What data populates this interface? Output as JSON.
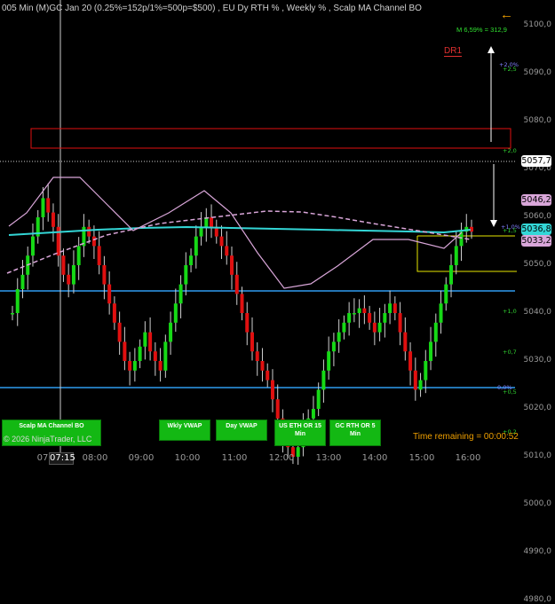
{
  "title": "005 Min (M)GC Jan 20  (0.25%=152p/1%=500p=$500) , EU Dy RTH % , Weekly % , Scalp MA Channel BO",
  "price_ticks": [
    "5100,0",
    "5090,0",
    "5080,0",
    "5070,0",
    "5060,0",
    "5050,0",
    "5040,0",
    "5030,0",
    "5020,0",
    "5010,0",
    "5000,0",
    "4990,0",
    "4980,0"
  ],
  "time_ticks": [
    "07:15",
    "08:00",
    "09:00",
    "10:00",
    "11:00",
    "12:00",
    "13:00",
    "14:00",
    "15:00",
    "16:00"
  ],
  "time_prefix": "07",
  "price_badges": [
    {
      "label": "5057,7",
      "bg": "#ffffff"
    },
    {
      "label": "5046,2",
      "bg": "#d9a6d9"
    },
    {
      "label": "5036,8",
      "bg": "#33d6d6"
    },
    {
      "label": "5033,2",
      "bg": "#d9a6d9"
    }
  ],
  "channel_labels": [
    {
      "text": "+2,5",
      "color": "#30d030"
    },
    {
      "text": "+2,0%",
      "color": "#8080ff"
    },
    {
      "text": "+2,0",
      "color": "#30d030"
    },
    {
      "text": "+1,0%",
      "color": "#8080ff"
    },
    {
      "text": "+1,5",
      "color": "#30d030"
    },
    {
      "text": "+1,0",
      "color": "#30d030"
    },
    {
      "text": "+0,7",
      "color": "#30d030"
    },
    {
      "text": "0,0%",
      "color": "#8080ff"
    },
    {
      "text": "+0,5",
      "color": "#30d030"
    },
    {
      "text": "+0,2",
      "color": "#30d030"
    }
  ],
  "measure_label": "M 6,59% = 312,9",
  "dr_label": "DR1",
  "buttons": {
    "scalp": "Scalp MA Channel BO",
    "wkly_vwap": "Wkly VWAP",
    "day_vwap": "Day VWAP",
    "us_eth": "US ETH OR 15 Min",
    "gc_rth": "GC RTH OR 5 Min"
  },
  "copyright": "© 2026 NinjaTrader, LLC",
  "time_remaining": "Time remaining = 00:00:52",
  "colors": {
    "up": "#16d916",
    "down": "#e01010",
    "magenta": "#d9a6d9",
    "cyan": "#33d6d6",
    "blue": "#2f9cf0",
    "yellow": "#e6e600",
    "box": "#e01010"
  }
}
